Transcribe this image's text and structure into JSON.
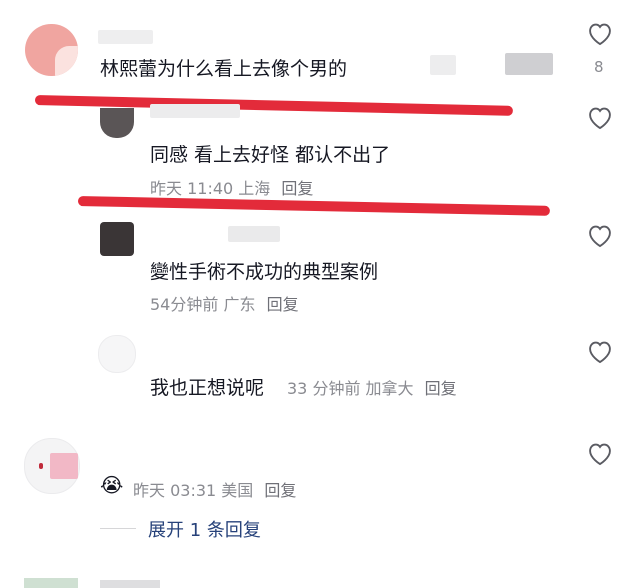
{
  "comments": [
    {
      "text": "林熙蕾为什么看上去像个男的",
      "like_count": "8"
    },
    {
      "text": "同感 看上去好怪 都认不出了",
      "time": "昨天 11:40",
      "location": "上海",
      "reply": "回复"
    },
    {
      "text": "變性手術不成功的典型案例",
      "time": "54分钟前",
      "location": "广东",
      "reply": "回复"
    },
    {
      "text": "我也正想说呢",
      "time": "33 分钟前",
      "location": "加拿大",
      "reply": "回复"
    },
    {
      "emoji": "😭",
      "time": "昨天 03:31",
      "location": "美国",
      "reply": "回复"
    }
  ],
  "expand_replies": "展开 1 条回复",
  "colors": {
    "annotation_red": "#e32b3a",
    "text": "#161823",
    "meta": "#8a8b91",
    "link": "#27427a"
  },
  "icons": [
    "heart-outline-icon",
    "crying-emoji-icon"
  ]
}
